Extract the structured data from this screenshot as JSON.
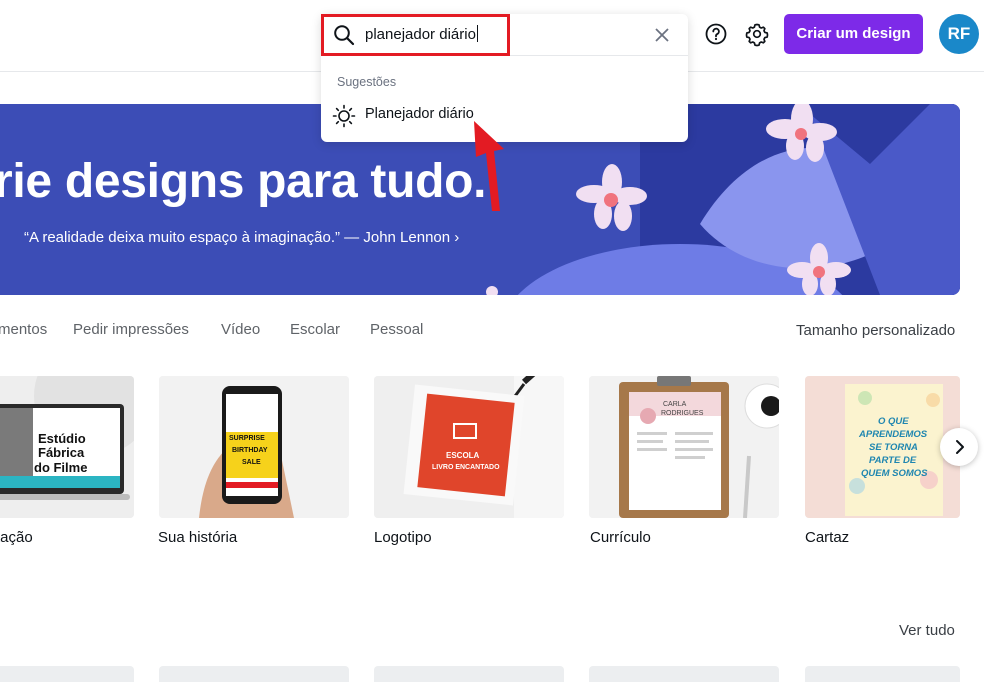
{
  "header": {
    "search": {
      "query": "planejador diário",
      "suggestions_label": "Sugestões",
      "suggestion": "Planejador diário"
    },
    "create_button": "Criar um design",
    "avatar_initials": "RF"
  },
  "hero": {
    "title": "rie designs para tudo.",
    "quote": "“A realidade deixa muito espaço à imaginação.” — John Lennon ›"
  },
  "categories": [
    "mentos",
    "Pedir impressões",
    "Vídeo",
    "Escolar",
    "Pessoal"
  ],
  "custom_size": "Tamanho personalizado",
  "cards": [
    {
      "label": "tação",
      "art": {
        "l1": "Estúdio",
        "l2": "Fábrica",
        "l3": "do Filme"
      }
    },
    {
      "label": "Sua história",
      "art": {
        "l1": "SURPRISE",
        "l2": "BIRTHDAY",
        "l3": "SALE"
      }
    },
    {
      "label": "Logotipo",
      "art": {
        "l1": "ESCOLA",
        "l2": "LIVRO ENCANTADO"
      }
    },
    {
      "label": "Currículo",
      "art": {
        "l1": "CARLA",
        "l2": "RODRIGUES"
      }
    },
    {
      "label": "Cartaz",
      "art": {
        "l1": "O QUE",
        "l2": "APRENDEMOS",
        "l3": "SE TORNA",
        "l4": "PARTE DE",
        "l5": "QUEM SOMOS"
      }
    }
  ],
  "view_all": "Ver tudo",
  "colors": {
    "brand_purple": "#7d2ae8",
    "hero_blue": "#3c4db6",
    "highlight_red": "#e31b23",
    "avatar_blue": "#1a88c9"
  }
}
